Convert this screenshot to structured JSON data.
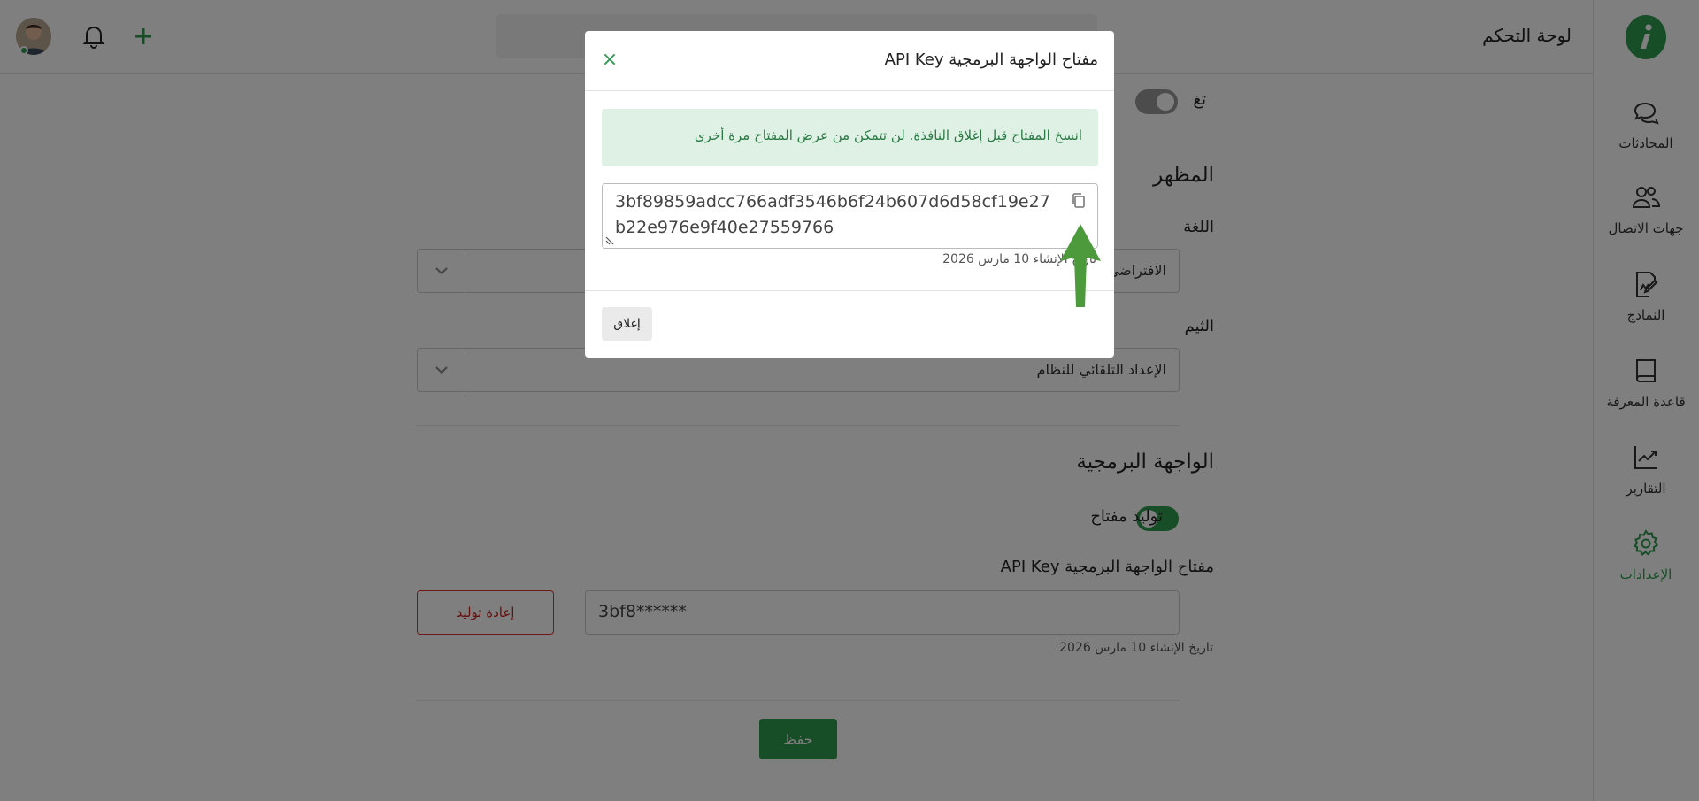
{
  "header": {
    "title": "لوحة التحكم"
  },
  "sidebar": {
    "items": [
      {
        "label": "المحادثات",
        "icon": "chat-bubbles-icon"
      },
      {
        "label": "جهات الاتصال",
        "icon": "contacts-icon"
      },
      {
        "label": "النماذج",
        "icon": "form-edit-icon"
      },
      {
        "label": "قاعدة المعرفة",
        "icon": "book-icon"
      },
      {
        "label": "التقارير",
        "icon": "chart-line-icon"
      },
      {
        "label": "الإعدادات",
        "icon": "gear-icon",
        "active": true
      }
    ]
  },
  "settings": {
    "partial_toggle_label": "تغ",
    "appearance": {
      "title": "المظهر",
      "language_label": "اللغة",
      "language_value": "الافتراضي",
      "theme_label": "الثيم",
      "theme_value": "الإعداد التلقائي للنظام"
    },
    "api": {
      "title": "الواجهة البرمجية",
      "generate_toggle_label": "توليد مفتاح",
      "key_label": "مفتاح الواجهة البرمجية API Key",
      "masked_key": "3bf8******",
      "created_hint": "تاريخ الإنشاء 10 مارس 2026",
      "regenerate_button": "إعادة توليد"
    },
    "save_button": "حفظ"
  },
  "modal": {
    "title": "مفتاح الواجهة البرمجية API Key",
    "close_symbol": "×",
    "alert_text": "انسخ المفتاح قبل إغلاق النافذة. لن تتمكن من عرض المفتاح مرة أخرى",
    "api_key": "3bf89859adcc766adf3546b6f24b607d6d58cf19e27b22e976e9f40e27559766",
    "created_hint": "تاريخ الإنشاء 10 مارس 2026",
    "close_button": "إغلاق"
  },
  "colors": {
    "brand_green": "#2f9a4f",
    "danger_red": "#cc2222",
    "alert_bg": "#dff1e5"
  }
}
